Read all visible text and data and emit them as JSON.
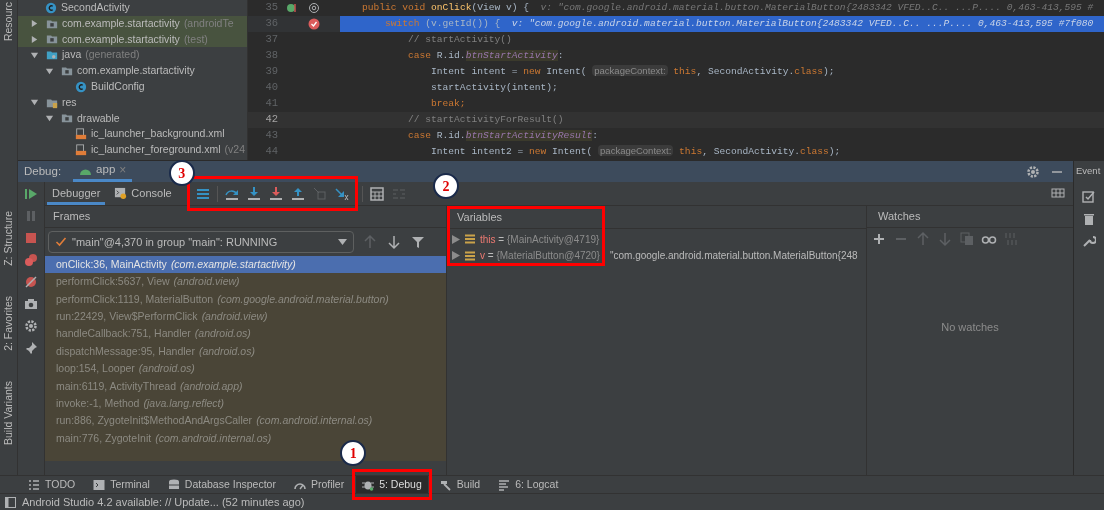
{
  "side_labels": [
    {
      "label": "Resourc"
    },
    {
      "label": "Z: Structure"
    },
    {
      "label": "2: Favorites"
    },
    {
      "label": "Build Variants"
    }
  ],
  "project_tree": [
    {
      "label": "SecondActivity",
      "kind": "class"
    },
    {
      "label": "com.example.startactivity",
      "note": "(androidTe",
      "kind": "test-package",
      "expanded": false
    },
    {
      "label": "com.example.startactivity",
      "note": "(test)",
      "kind": "test-package",
      "expanded": false
    },
    {
      "label": "java",
      "note": "(generated)",
      "kind": "source-folder",
      "expanded": true,
      "children": [
        {
          "label": "com.example.startactivity",
          "kind": "package",
          "expanded": true,
          "children": [
            {
              "label": "BuildConfig",
              "kind": "class"
            }
          ]
        }
      ]
    },
    {
      "label": "res",
      "kind": "res-folder",
      "expanded": true,
      "children": [
        {
          "label": "drawable",
          "kind": "package",
          "expanded": true,
          "children": [
            {
              "label": "ic_launcher_background.xml",
              "kind": "xml"
            },
            {
              "label": "ic_launcher_foreground.xml",
              "note": "(v24",
              "kind": "xml"
            }
          ]
        }
      ]
    }
  ],
  "editor": {
    "lines": [
      {
        "number": "35",
        "kind": "override",
        "highlighted": false,
        "caret": false,
        "segments": [
          {
            "t": "public void ",
            "kind": "kw"
          },
          {
            "t": "onClick",
            "kind": "method"
          },
          {
            "t": "(View v) {  ",
            "kind": "plain"
          },
          {
            "t": "v: \"com.google.android.material.button.MaterialButton{2483342 VFED..C.. ...P.... 0,463-413,595 #",
            "kind": "inline"
          }
        ]
      },
      {
        "number": "36",
        "kind": "breakpoint",
        "highlighted": true,
        "caret": false,
        "segments": [
          {
            "t": "    switch ",
            "kind": "kw"
          },
          {
            "t": "(v.getId()) {  ",
            "kind": "plain"
          },
          {
            "t": "v: \"com.google.android.material.button.MaterialButton{2483342 VFED..C.. ...P.... 0,463-413,595 #7f080",
            "kind": "inline"
          }
        ]
      },
      {
        "number": "37",
        "kind": "plain",
        "highlighted": false,
        "caret": false,
        "segments": [
          {
            "t": "        // startActivity()",
            "kind": "comment"
          }
        ]
      },
      {
        "number": "38",
        "kind": "plain",
        "highlighted": false,
        "caret": false,
        "segments": [
          {
            "t": "        case ",
            "kind": "kw"
          },
          {
            "t": "R.id.",
            "kind": "plain"
          },
          {
            "t": "btnStartActivity",
            "kind": "field"
          },
          {
            "t": ":",
            "kind": "plain"
          }
        ]
      },
      {
        "number": "39",
        "kind": "plain",
        "highlighted": false,
        "caret": false,
        "segments": [
          {
            "t": "            Intent intent = ",
            "kind": "plain"
          },
          {
            "t": "new ",
            "kind": "kw"
          },
          {
            "t": "Intent( ",
            "kind": "plain"
          },
          {
            "t": "packageContext:",
            "kind": "hint"
          },
          {
            "t": " this",
            "kind": "kw"
          },
          {
            "t": ", SecondActivity.",
            "kind": "plain"
          },
          {
            "t": "class",
            "kind": "kw"
          },
          {
            "t": ");",
            "kind": "plain"
          }
        ]
      },
      {
        "number": "40",
        "kind": "plain",
        "highlighted": false,
        "caret": false,
        "segments": [
          {
            "t": "            startActivity(intent);",
            "kind": "plain"
          }
        ]
      },
      {
        "number": "41",
        "kind": "plain",
        "highlighted": false,
        "caret": false,
        "segments": [
          {
            "t": "            break;",
            "kind": "kw"
          }
        ]
      },
      {
        "number": "42",
        "kind": "plain",
        "highlighted": false,
        "caret": true,
        "segments": [
          {
            "t": "        // startActivityForResult()",
            "kind": "comment"
          }
        ]
      },
      {
        "number": "43",
        "kind": "plain",
        "highlighted": false,
        "caret": false,
        "segments": [
          {
            "t": "        case ",
            "kind": "kw"
          },
          {
            "t": "R.id.",
            "kind": "plain"
          },
          {
            "t": "btnStartActivityResult",
            "kind": "field"
          },
          {
            "t": ":",
            "kind": "plain"
          }
        ]
      },
      {
        "number": "44",
        "kind": "plain",
        "highlighted": false,
        "caret": false,
        "segments": [
          {
            "t": "            Intent intent2 = ",
            "kind": "plain"
          },
          {
            "t": "new ",
            "kind": "kw"
          },
          {
            "t": "Intent( ",
            "kind": "plain"
          },
          {
            "t": "packageContext:",
            "kind": "hint"
          },
          {
            "t": " this",
            "kind": "kw"
          },
          {
            "t": ", SecondActivity.",
            "kind": "plain"
          },
          {
            "t": "class",
            "kind": "kw"
          },
          {
            "t": ");",
            "kind": "plain"
          }
        ]
      }
    ]
  },
  "debug": {
    "title": "Debug:",
    "session_tab": "app",
    "close": "×",
    "tabs": [
      {
        "label": "Debugger",
        "selected": true
      },
      {
        "label": "Console",
        "selected": false
      }
    ],
    "side_actions": [
      {
        "kind": "resume",
        "disabled": false
      },
      {
        "kind": "pause",
        "disabled": true
      },
      {
        "kind": "stop",
        "disabled": false
      },
      {
        "kind": "breakpoints",
        "disabled": false
      },
      {
        "kind": "mute",
        "disabled": false
      },
      {
        "kind": "camera",
        "disabled": false
      },
      {
        "kind": "settings",
        "disabled": false
      },
      {
        "kind": "pin",
        "disabled": false
      }
    ],
    "step_actions": [
      {
        "kind": "execution-point",
        "disabled": false
      },
      {
        "kind": "step-over",
        "disabled": false
      },
      {
        "kind": "step-into",
        "disabled": false
      },
      {
        "kind": "force-step-into",
        "disabled": false
      },
      {
        "kind": "step-out",
        "disabled": false
      },
      {
        "kind": "drop-frame",
        "disabled": true
      },
      {
        "kind": "run-to-cursor",
        "disabled": false
      }
    ],
    "extra_actions": [
      {
        "kind": "evaluate",
        "disabled": false
      },
      {
        "kind": "trace",
        "disabled": true
      }
    ],
    "frames": {
      "header": "Frames",
      "thread": "\"main\"@4,370 in group \"main\": RUNNING",
      "actions": [
        {
          "kind": "up",
          "disabled": true
        },
        {
          "kind": "down",
          "disabled": false
        },
        {
          "kind": "filter",
          "disabled": false
        }
      ],
      "items": [
        {
          "name": "onClick:36, MainActivity",
          "package": "(com.example.startactivity)",
          "selected": true
        },
        {
          "name": "performClick:5637, View",
          "package": "(android.view)",
          "selected": false
        },
        {
          "name": "performClick:1119, MaterialButton",
          "package": "(com.google.android.material.button)",
          "selected": false
        },
        {
          "name": "run:22429, View$PerformClick",
          "package": "(android.view)",
          "selected": false
        },
        {
          "name": "handleCallback:751, Handler",
          "package": "(android.os)",
          "selected": false
        },
        {
          "name": "dispatchMessage:95, Handler",
          "package": "(android.os)",
          "selected": false
        },
        {
          "name": "loop:154, Looper",
          "package": "(android.os)",
          "selected": false
        },
        {
          "name": "main:6119, ActivityThread",
          "package": "(android.app)",
          "selected": false
        },
        {
          "name": "invoke:-1, Method",
          "package": "(java.lang.reflect)",
          "selected": false
        },
        {
          "name": "run:886, ZygoteInit$MethodAndArgsCaller",
          "package": "(com.android.internal.os)",
          "selected": false
        },
        {
          "name": "main:776, ZygoteInit",
          "package": "(com.android.internal.os)",
          "selected": false
        }
      ]
    },
    "variables": {
      "header": "Variables",
      "items": [
        {
          "name": "this",
          "separator": "=",
          "value": "{MainActivity@4719}",
          "expanded": false
        },
        {
          "name": "v",
          "separator": "=",
          "value": "{MaterialButton@4720}",
          "text": "\"com.google.android.material.button.MaterialButton{248",
          "expanded": false
        }
      ]
    },
    "watches": {
      "header": "Watches",
      "empty": "No watches",
      "actions": [
        {
          "kind": "add",
          "disabled": false
        },
        {
          "kind": "remove",
          "disabled": true
        },
        {
          "kind": "up",
          "disabled": true
        },
        {
          "kind": "down",
          "disabled": true
        },
        {
          "kind": "copy",
          "disabled": true
        },
        {
          "kind": "glasses",
          "disabled": false
        },
        {
          "kind": "binary",
          "disabled": true
        }
      ]
    },
    "right_panel": {
      "title": "Event"
    }
  },
  "tool_windows": [
    {
      "label": "TODO",
      "kind": "list",
      "selected": false
    },
    {
      "label": "Terminal",
      "kind": "terminal",
      "selected": false
    },
    {
      "label": "Database Inspector",
      "kind": "database",
      "selected": false
    },
    {
      "label": "Profiler",
      "kind": "gauge",
      "selected": false
    },
    {
      "label": "5: Debug",
      "kind": "bug",
      "selected": true
    },
    {
      "label": "Build",
      "kind": "hammer",
      "selected": false
    },
    {
      "label": "6: Logcat",
      "kind": "log",
      "selected": false
    }
  ],
  "status_bar": {
    "text": "Android Studio 4.2 available: // Update... (52 minutes ago)"
  },
  "callouts": [
    {
      "number": "1"
    },
    {
      "number": "2"
    },
    {
      "number": "3"
    }
  ]
}
